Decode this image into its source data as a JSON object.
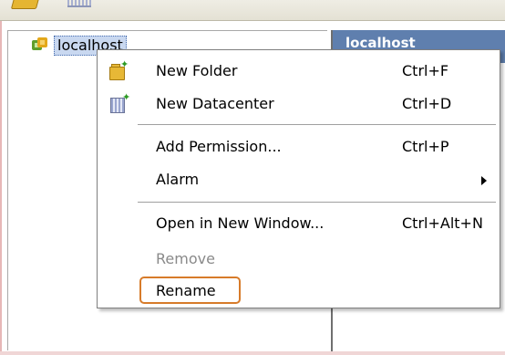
{
  "tree": {
    "host_label": "localhost"
  },
  "right_panel": {
    "header_text": "localhost"
  },
  "context_menu": {
    "items": [
      {
        "label": "New Folder",
        "shortcut": "Ctrl+F",
        "icon": "new-folder-icon"
      },
      {
        "label": "New Datacenter",
        "shortcut": "Ctrl+D",
        "icon": "new-datacenter-icon"
      },
      {
        "label": "Add Permission...",
        "shortcut": "Ctrl+P"
      },
      {
        "label": "Alarm",
        "shortcut": "",
        "submenu": true
      },
      {
        "label": "Open in New Window...",
        "shortcut": "Ctrl+Alt+N"
      },
      {
        "label": "Remove",
        "shortcut": "",
        "disabled": true
      },
      {
        "label": "Rename",
        "shortcut": "",
        "highlighted": true
      }
    ]
  },
  "colors": {
    "highlight_border": "#d77b2a",
    "header_bg": "#5f7fae",
    "selection_bg": "#c9d8f0"
  }
}
